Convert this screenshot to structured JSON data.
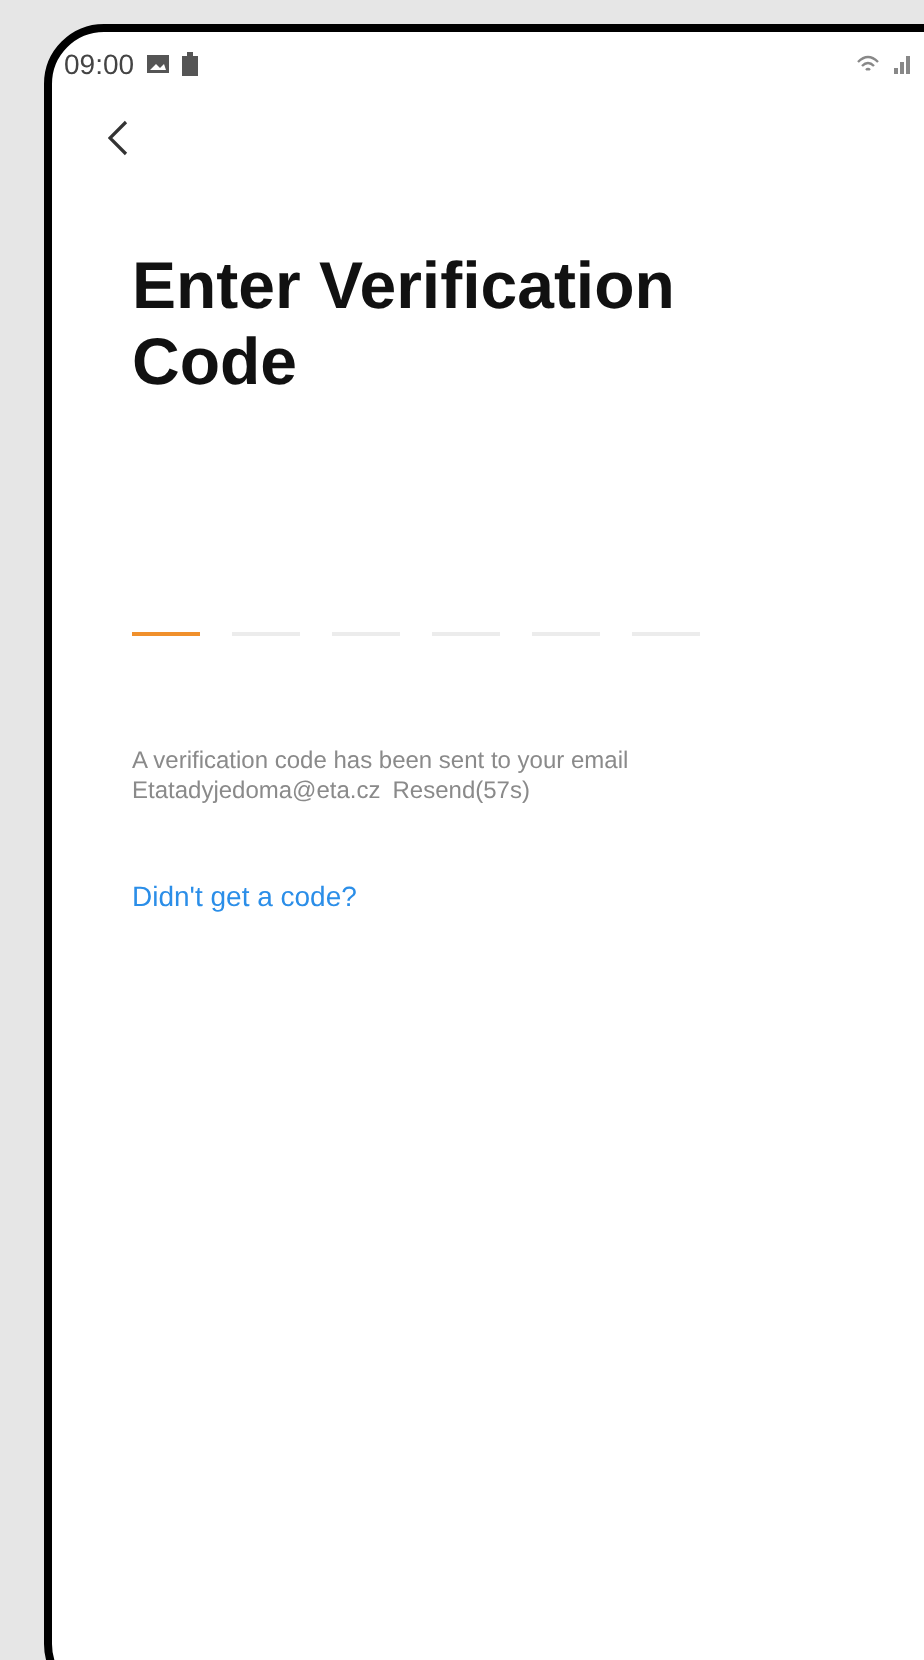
{
  "status_bar": {
    "time": "09:00"
  },
  "title": "Enter Verification Code",
  "code_slots": [
    {
      "selected": true
    },
    {
      "selected": false
    },
    {
      "selected": false
    },
    {
      "selected": false
    },
    {
      "selected": false
    },
    {
      "selected": false
    }
  ],
  "message": "A verification code has been sent to your email",
  "email": "Etatadyjedoma@eta.cz",
  "resend": "Resend(57s)",
  "help_link": "Didn't get a code?"
}
